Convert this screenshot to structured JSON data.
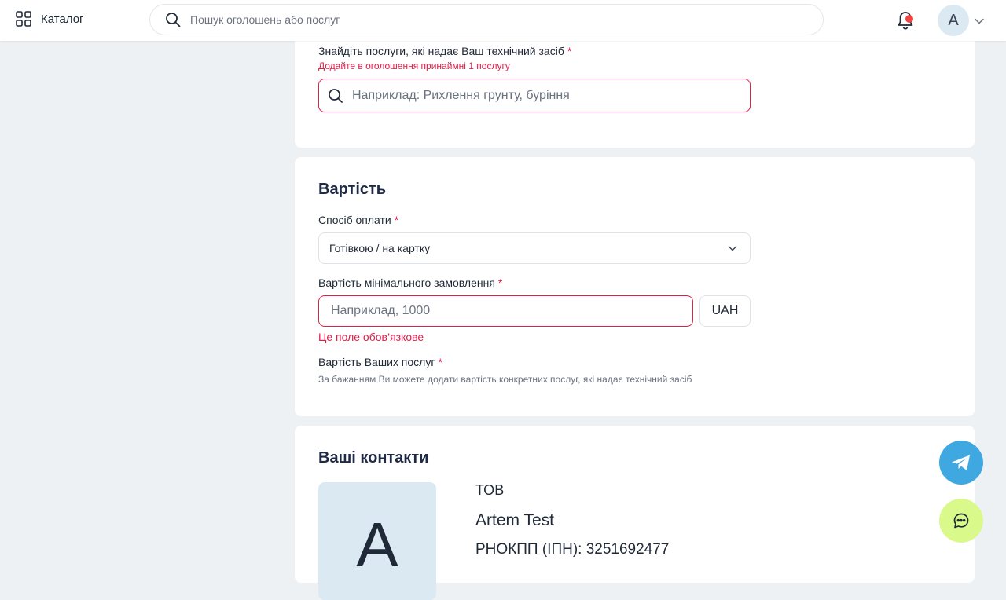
{
  "header": {
    "catalog_label": "Каталог",
    "search_placeholder": "Пошук оголошень або послуг",
    "avatar_letter": "A"
  },
  "services": {
    "label": "Знайдіть послуги, які надає Ваш технічний засіб",
    "required_mark": "*",
    "error": "Додайте в оголошення принаймні 1 послугу",
    "input_placeholder": "Наприклад: Рихлення грунту, буріння"
  },
  "cost": {
    "title": "Вартість",
    "payment_label": "Спосіб оплати",
    "payment_value": "Готівкою / на картку",
    "min_order_label": "Вартість мінімального замовлення",
    "min_order_placeholder": "Наприклад, 1000",
    "currency": "UAH",
    "min_order_error": "Це поле обов’язкове",
    "services_cost_label": "Вартість Ваших послуг",
    "services_cost_hint": "За бажанням Ви можете додати вартість конкретних послуг, які надає технічний засіб"
  },
  "contacts": {
    "title": "Ваші контакти",
    "avatar_letter": "A",
    "company_type": "ТОВ",
    "name": "Artem Test",
    "tax_id": "РНОКПП (ІПН): 3251692477"
  },
  "colors": {
    "accent_error": "#e11d48",
    "telegram": "#3fa8e0",
    "chat": "#d9f98a",
    "notification_dot": "#ef4444"
  },
  "icons": [
    "grid-icon",
    "search-icon",
    "bell-icon",
    "chevron-down-icon",
    "telegram-icon",
    "chat-icon"
  ]
}
